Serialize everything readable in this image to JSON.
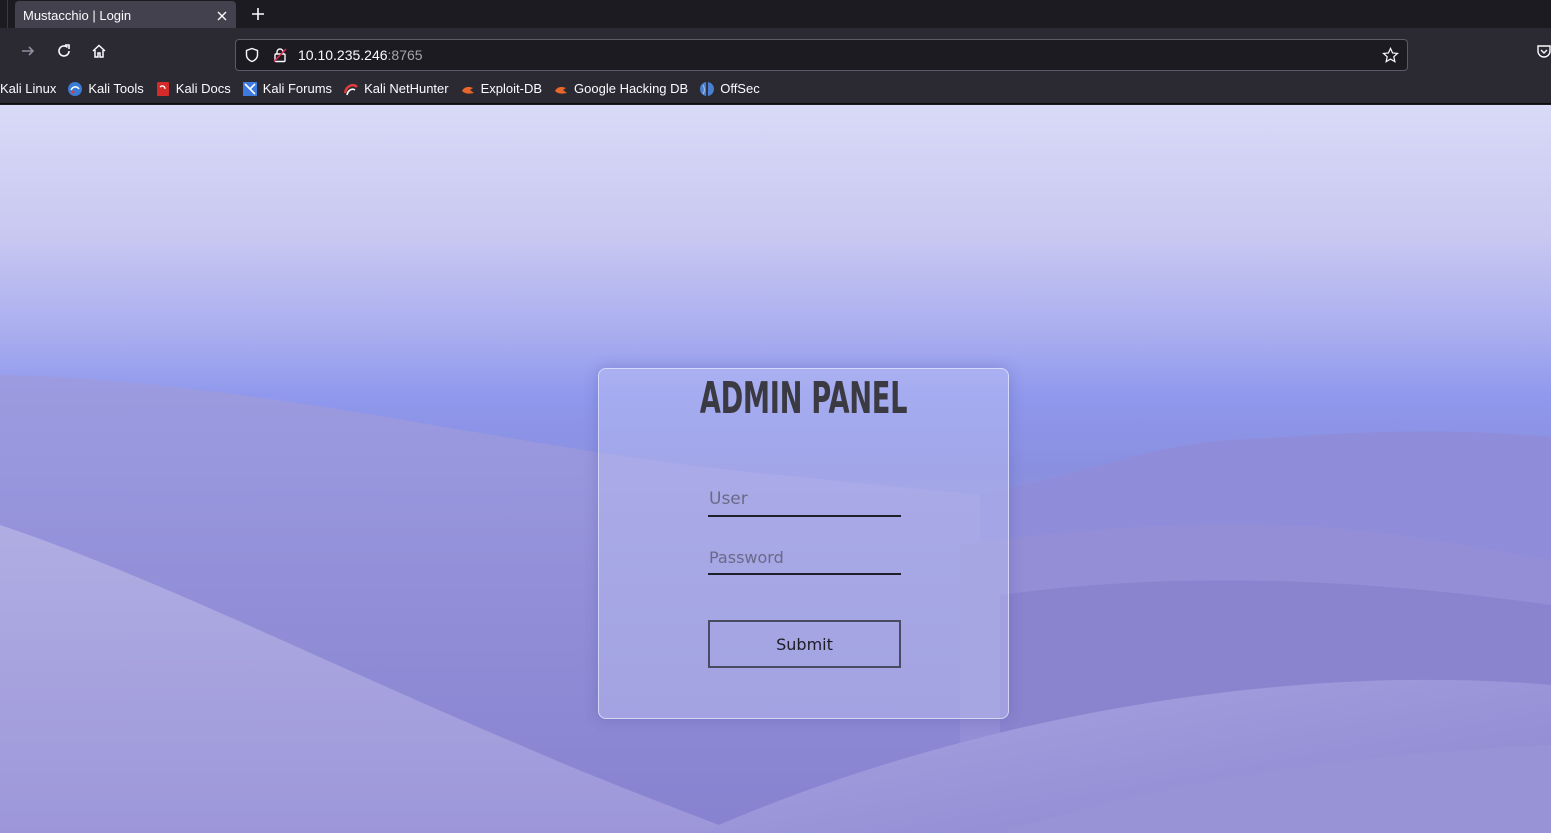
{
  "browser": {
    "tab": {
      "title": "Mustacchio | Login"
    },
    "url": {
      "host": "10.10.235.246",
      "port": ":8765"
    },
    "bookmarks": [
      {
        "label": "Kali Linux",
        "icon": "none"
      },
      {
        "label": "Kali Tools",
        "icon": "kali-tools-icon",
        "color": "#3a7bd5"
      },
      {
        "label": "Kali Docs",
        "icon": "kali-docs-icon",
        "color": "#d42a2a"
      },
      {
        "label": "Kali Forums",
        "icon": "kali-forums-icon",
        "color": "#3d7be0"
      },
      {
        "label": "Kali NetHunter",
        "icon": "kali-nethunter-icon",
        "color": "#e03c3c"
      },
      {
        "label": "Exploit-DB",
        "icon": "exploit-db-icon",
        "color": "#e8662c"
      },
      {
        "label": "Google Hacking DB",
        "icon": "google-hacking-db-icon",
        "color": "#e8662c"
      },
      {
        "label": "OffSec",
        "icon": "offsec-icon",
        "color": "#4a7fd0"
      }
    ]
  },
  "login": {
    "title": "ADMIN PANEL",
    "user_placeholder": "User",
    "password_placeholder": "Password",
    "submit_label": "Submit"
  }
}
